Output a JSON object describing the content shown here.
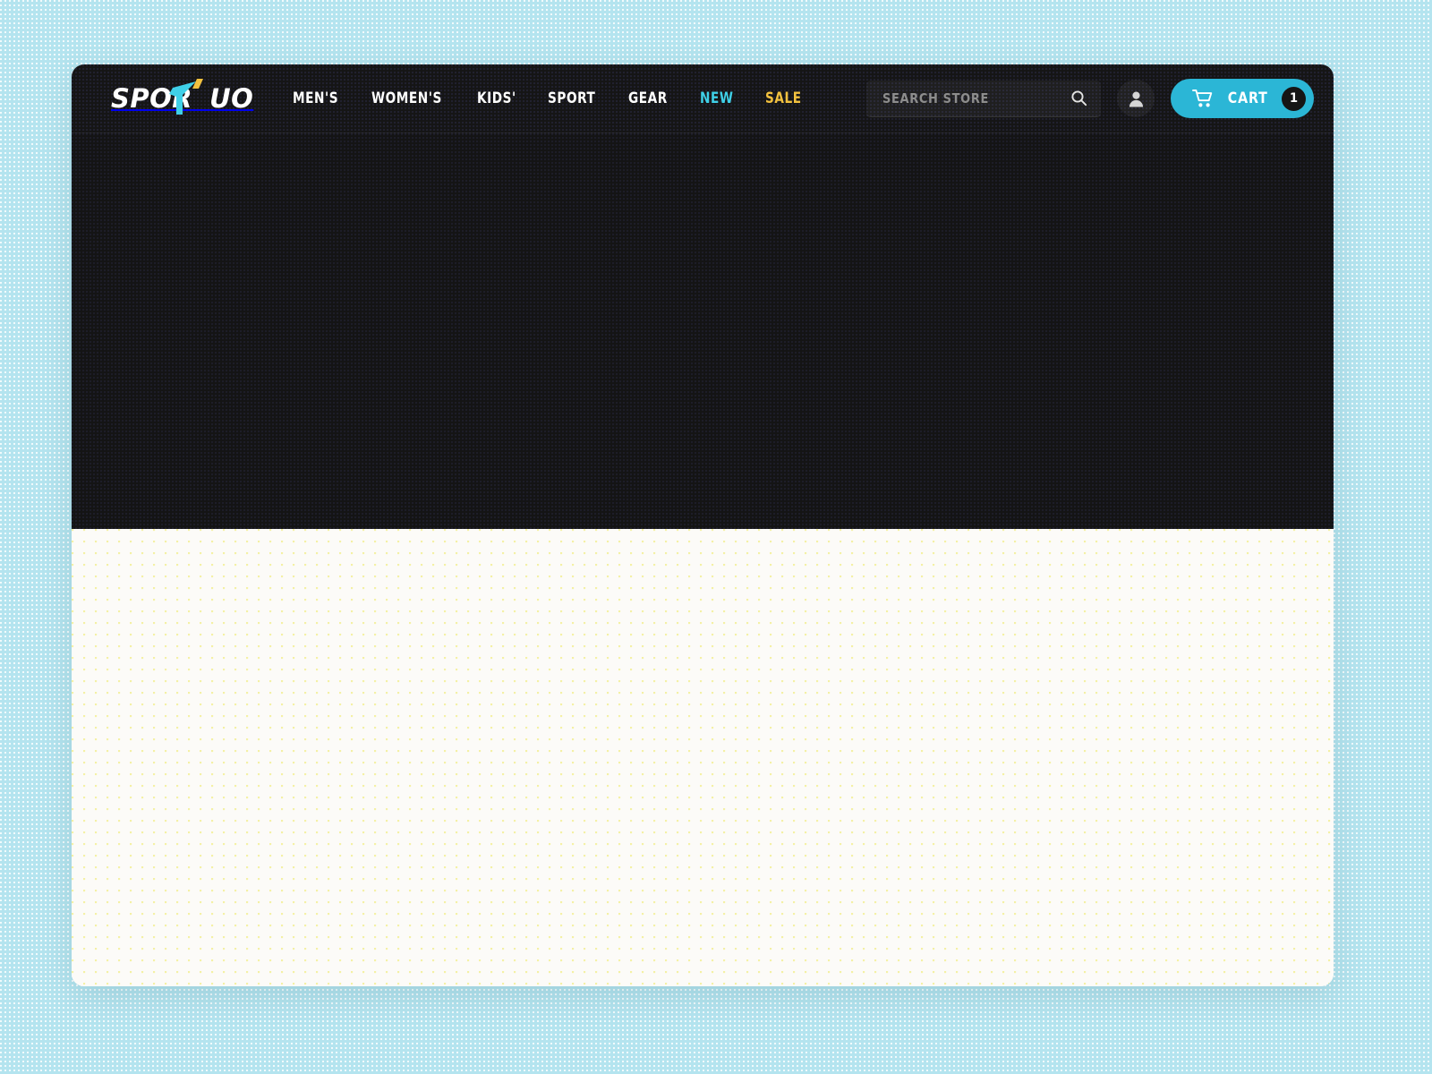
{
  "theme": {
    "page_background": "#b4e4ef",
    "header_background": "#151515",
    "hero_background": "#141414",
    "content_background": "#fcfbf8",
    "accent_cyan": "#2bb6d6",
    "accent_cyan_bright": "#3fd0e8",
    "accent_yellow": "#f2c13f",
    "text_on_dark": "#ffffff"
  },
  "header": {
    "logo": {
      "text_before": "SPOR",
      "text_after": "UO",
      "full_text": "SPORTUO",
      "mark_icon": "arrow-swoosh-icon",
      "mark_color": "#3fd0e8",
      "mark_accent_color": "#f2c13f"
    },
    "nav": [
      {
        "label": "MEN'S",
        "style": "default"
      },
      {
        "label": "WOMEN'S",
        "style": "default"
      },
      {
        "label": "KIDS'",
        "style": "default"
      },
      {
        "label": "SPORT",
        "style": "default"
      },
      {
        "label": "GEAR",
        "style": "default"
      },
      {
        "label": "NEW",
        "style": "new"
      },
      {
        "label": "SALE",
        "style": "sale"
      }
    ],
    "search": {
      "placeholder": "SEARCH STORE",
      "value": "",
      "icon": "search-icon"
    },
    "account": {
      "icon": "user-icon",
      "label": "Account"
    },
    "cart": {
      "icon": "shopping-cart-icon",
      "label": "CART",
      "count": "1"
    }
  },
  "hero": {
    "content": ""
  },
  "content": {
    "content": ""
  }
}
